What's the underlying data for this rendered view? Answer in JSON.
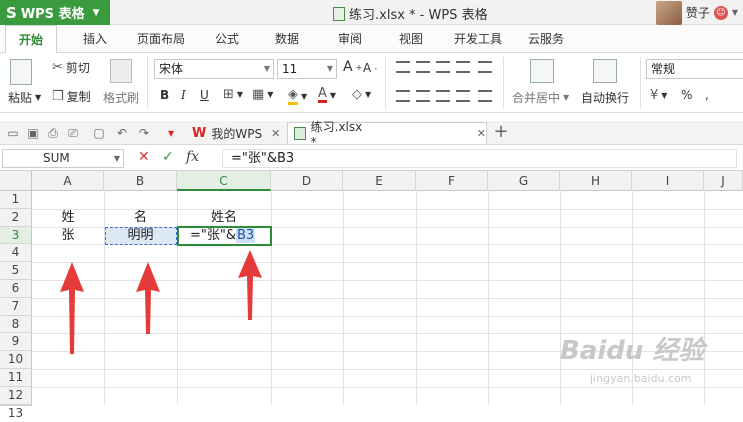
{
  "app": {
    "name": "WPS 表格",
    "document_title": "练习.xlsx * - WPS 表格",
    "user_name": "赞子",
    "user_badge": "☺"
  },
  "tabs": [
    {
      "label": "开始",
      "active": true
    },
    {
      "label": "插入"
    },
    {
      "label": "页面布局"
    },
    {
      "label": "公式"
    },
    {
      "label": "数据"
    },
    {
      "label": "审阅"
    },
    {
      "label": "视图"
    },
    {
      "label": "开发工具"
    },
    {
      "label": "云服务"
    }
  ],
  "ribbon": {
    "paste_label": "粘贴",
    "cut_label": "剪切",
    "copy_label": "复制",
    "format_painter_label": "格式刷",
    "font_name": "宋体",
    "font_size": "11",
    "merge_center_label": "合并居中",
    "wrap_text_label": "自动换行",
    "number_format": "常规",
    "percent_symbol": "%"
  },
  "doc_tabs": [
    {
      "label": "我的WPS"
    },
    {
      "label": "练习.xlsx *",
      "active": true
    }
  ],
  "formula_bar": {
    "name_box": "SUM",
    "cancel": "✕",
    "confirm": "✓",
    "fx": "fx",
    "formula": "=\"张\"&B3"
  },
  "sheet": {
    "columns": [
      "A",
      "B",
      "C",
      "D",
      "E",
      "F",
      "G",
      "H",
      "I",
      "J"
    ],
    "selected_column": "C",
    "rows": [
      "1",
      "2",
      "3",
      "4",
      "5",
      "6",
      "7",
      "8",
      "9",
      "10",
      "11",
      "12",
      "13"
    ],
    "selected_row": "3",
    "cells": {
      "A2": "姓",
      "B2": "名",
      "C2": "姓名",
      "A3": "张",
      "B3": "明明",
      "C3_prefix": "=\"张\"&",
      "C3_ref": "B3"
    }
  },
  "colors": {
    "accent_green": "#2e8b3a",
    "app_button_green": "#3a9a3e",
    "arrow_red": "#e63b3b",
    "ref_blue": "#3a6ec9"
  },
  "watermark": {
    "main": "Baidu 经验",
    "sub": "jingyan.baidu.com"
  }
}
